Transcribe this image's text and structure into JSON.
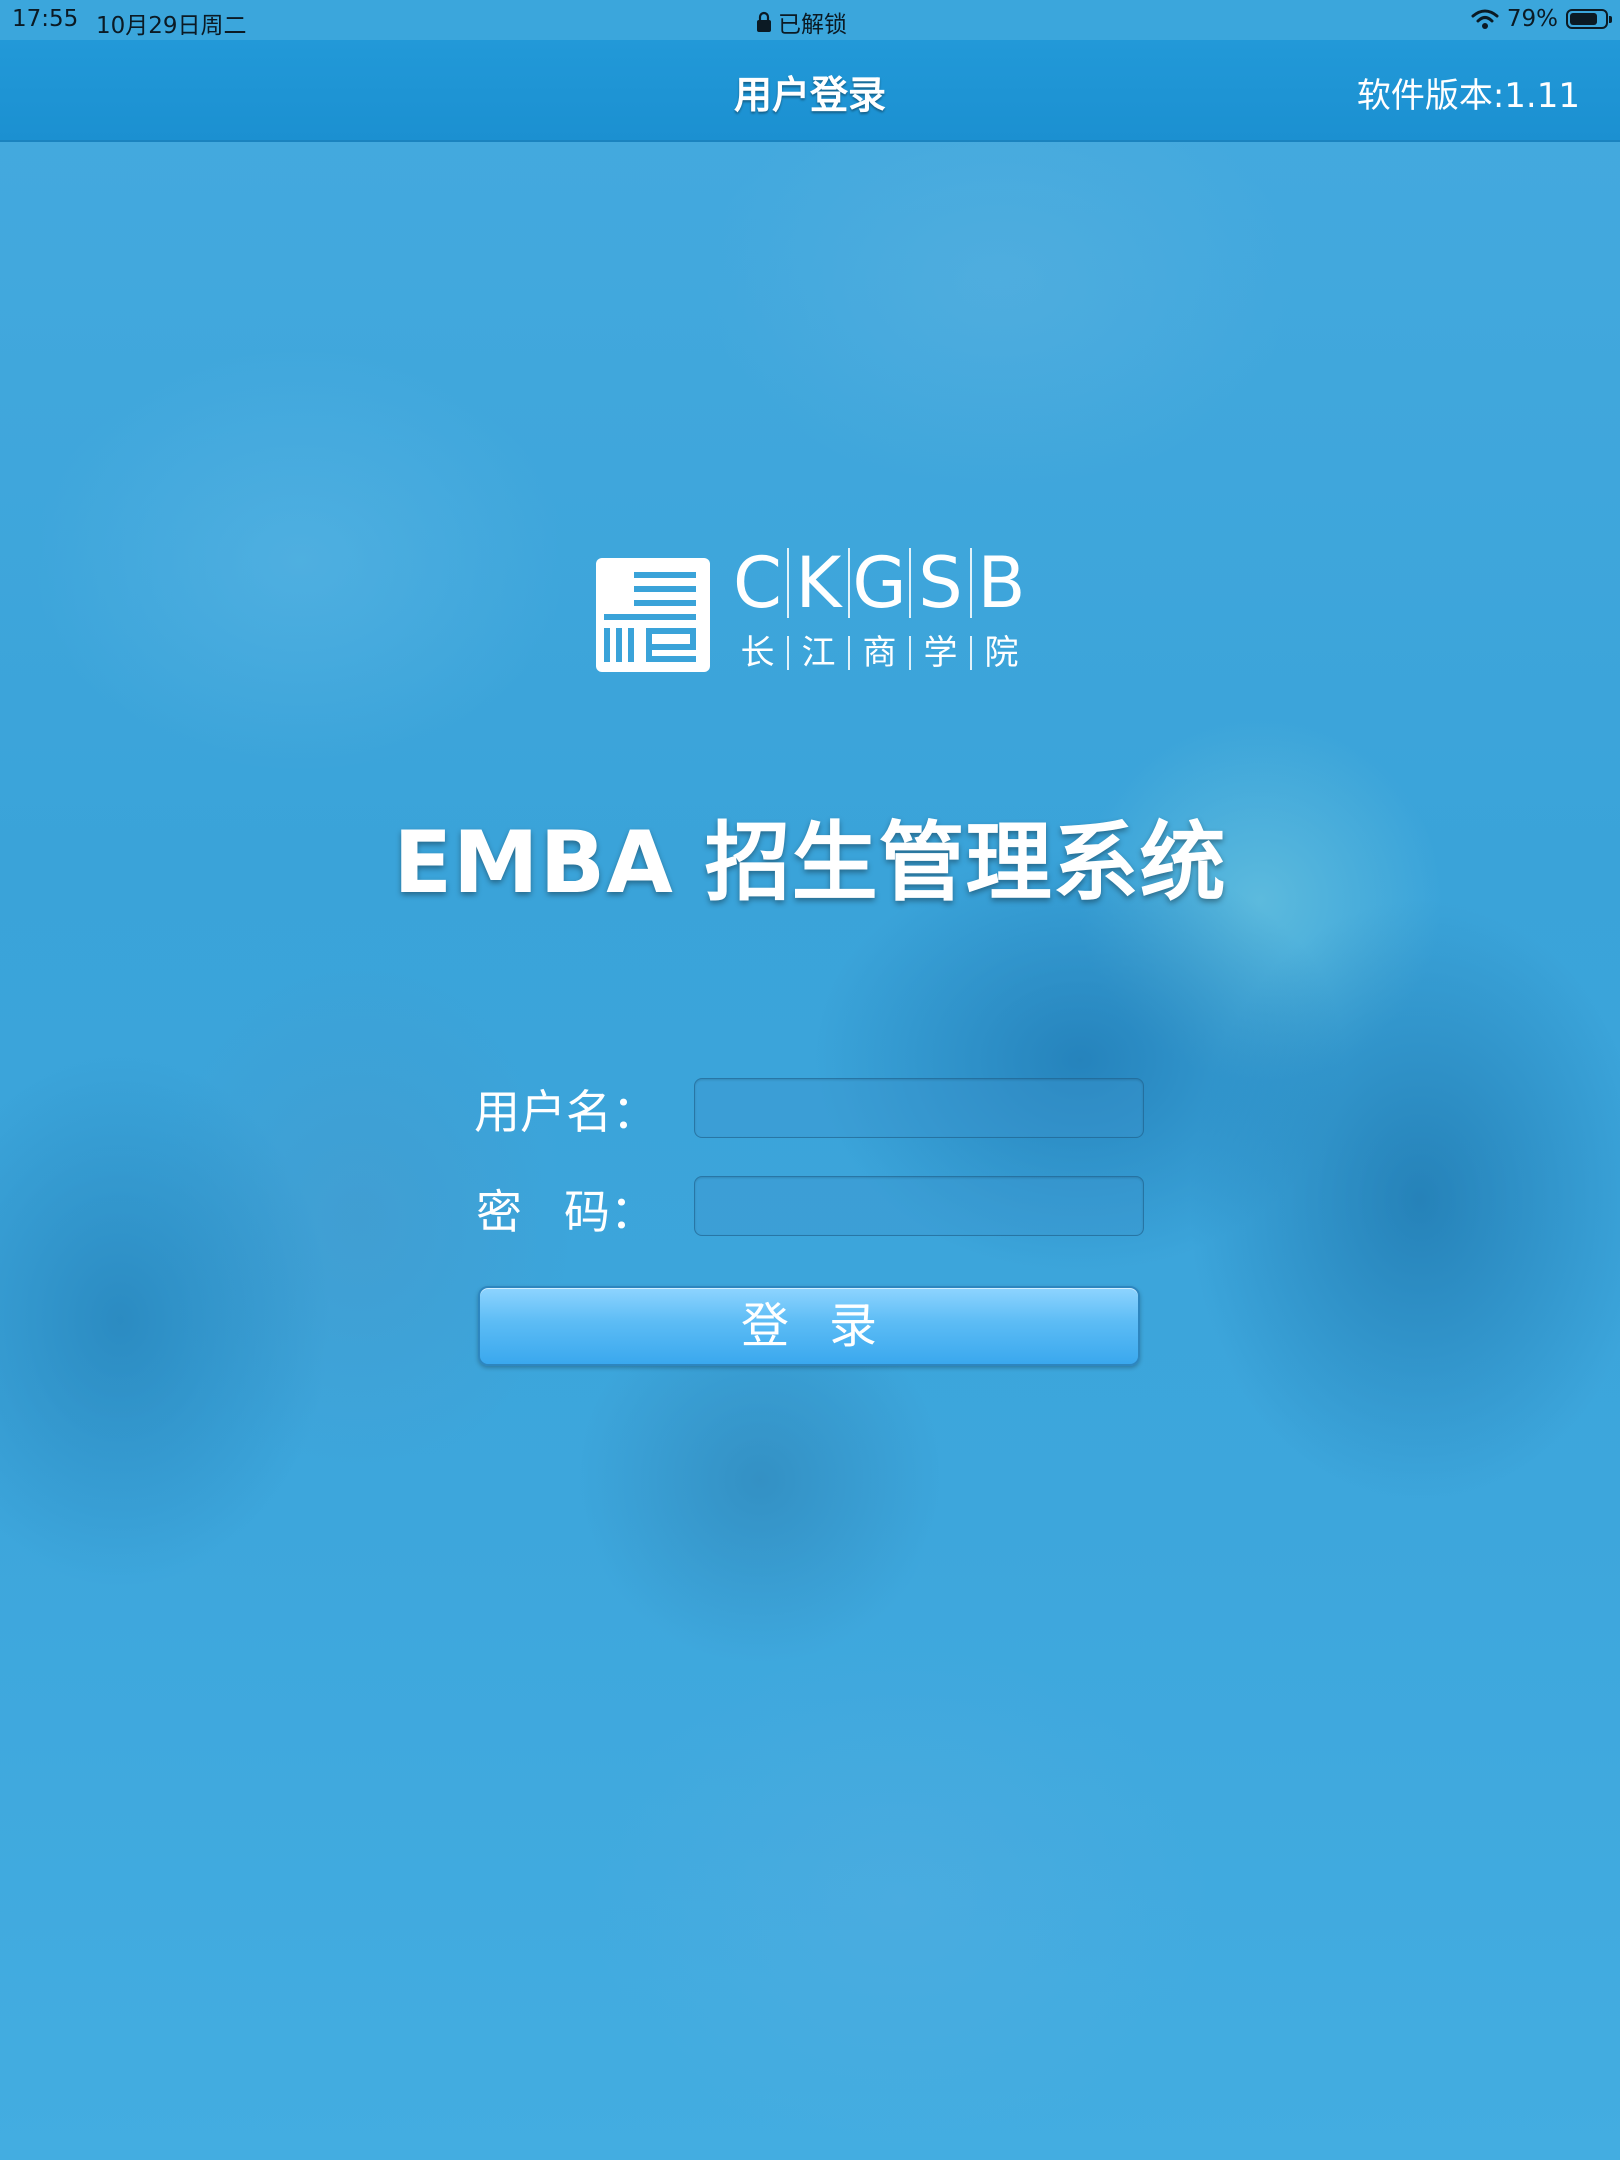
{
  "status_bar": {
    "time": "17:55",
    "date": "10月29日周二",
    "lock_text": "已解锁",
    "battery_percent": "79%",
    "battery_level": 0.79
  },
  "nav": {
    "title": "用户登录",
    "version": "软件版本:1.11"
  },
  "logo": {
    "latin_letters": [
      "C",
      "K",
      "G",
      "S",
      "B"
    ],
    "chinese_chars": [
      "长",
      "江",
      "商",
      "学",
      "院"
    ]
  },
  "app_title": "EMBA 招生管理系统",
  "form": {
    "username_label": "用户名：",
    "password_label_1": "密",
    "password_label_2": "码：",
    "username_value": "",
    "password_value": "",
    "login_button_label": "登录"
  },
  "colors": {
    "background": "#3ea6db",
    "nav_bar": "#1b90d1",
    "button": "#5cbcf5"
  }
}
